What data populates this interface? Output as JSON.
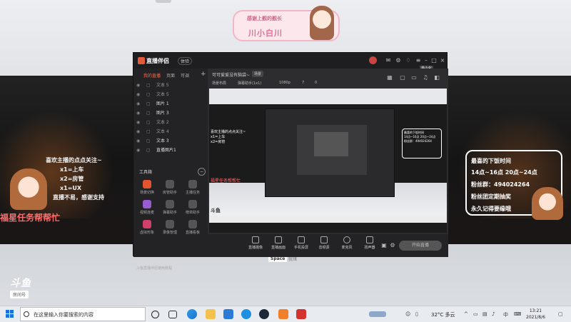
{
  "overlay": {
    "sticker_top": "感谢上舰的舰长",
    "sticker_name": "川小白川",
    "left_notes": [
      "喜欢主播的点点关注~",
      "x1=上车",
      "x2=房管",
      "x1=UX",
      "直播不易，感谢支持"
    ],
    "left_banner": "福星任务帮帮忙",
    "schedule": {
      "title": "最喜的下饭时间",
      "times": "14点~16点  20点~24点",
      "fan_group": "粉丝群：494024264",
      "line3": "粉丝团定期抽奖",
      "line4": "永久记得要缘哦"
    },
    "platform_logo": "斗鱼",
    "platform_room": "房间号",
    "space_tag": "Space",
    "space_tag2": "就绪"
  },
  "app": {
    "title": "直播伴侣",
    "version": "体验",
    "tooltip": "最小化",
    "tabs": [
      "我的直播",
      "页面",
      "可调"
    ],
    "scenes": [
      {
        "eye": "◉",
        "lock": "▢",
        "label": "文本 5",
        "on": false
      },
      {
        "eye": "◉",
        "lock": "▢",
        "label": "文本 5",
        "on": false
      },
      {
        "eye": "◉",
        "lock": "▢",
        "label": "图片 1",
        "on": true
      },
      {
        "eye": "◉",
        "lock": "▢",
        "label": "图片 3",
        "on": true
      },
      {
        "eye": "◉",
        "lock": "▢",
        "label": "文本 2",
        "on": false
      },
      {
        "eye": "◉",
        "lock": "▢",
        "label": "文本 4",
        "on": false
      },
      {
        "eye": "◉",
        "lock": "▢",
        "label": "文本 3",
        "on": true
      },
      {
        "eye": "◉",
        "lock": "▢",
        "label": "直播图片1",
        "on": true
      }
    ],
    "toolbox_title": "工具箱",
    "tools": [
      "场景切换",
      "房管助手",
      "主播任务",
      "视频连麦",
      "弹幕助手",
      "榜单助手",
      "虚拟形象",
      "录像管理",
      "直播看板"
    ],
    "footer_note": "斗鱼直播伴侣使用教程",
    "scene_name": "可可爱爱没有脑袋~",
    "scene_badge": "场景",
    "info_chips": [
      "场景布局",
      "弹幕助手(1x1)",
      "1080p",
      "7",
      "0"
    ],
    "controls": [
      "直播摄像",
      "直播画面",
      "手机投屏",
      "音频源",
      "麦克风",
      "扬声器"
    ],
    "start_live": "开始直播"
  },
  "taskbar": {
    "search_placeholder": "在这里输入你要搜索的内容",
    "weather": "32°C 多云",
    "time": "13:21",
    "date": "2021/8/6",
    "ime": "中"
  }
}
